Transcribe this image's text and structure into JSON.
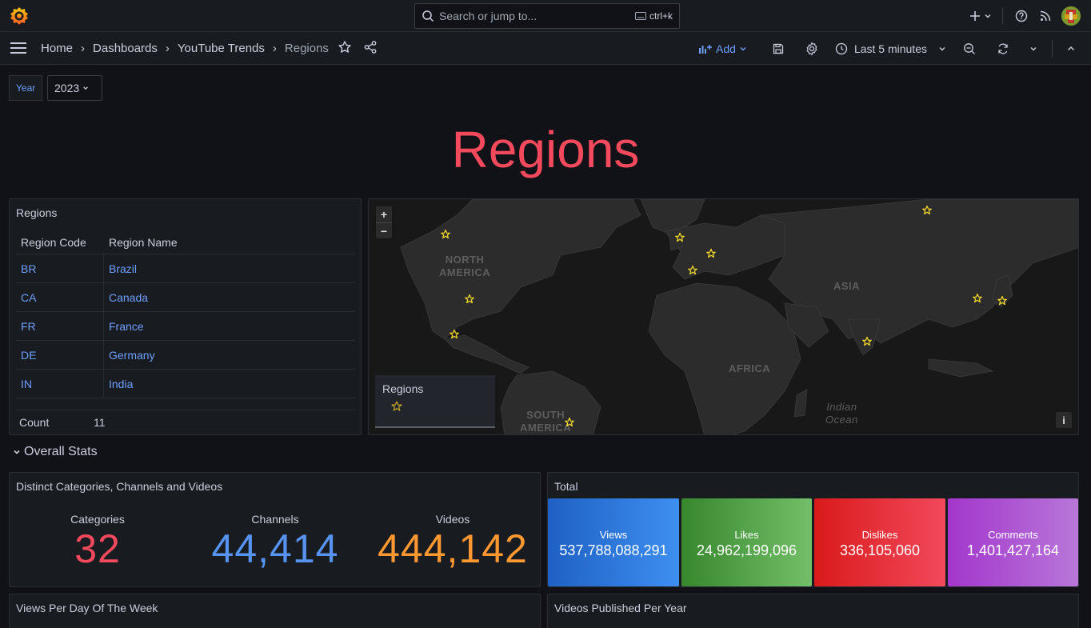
{
  "topbar": {
    "search_placeholder": "Search or jump to...",
    "search_shortcut": "ctrl+k"
  },
  "breadcrumb": {
    "home": "Home",
    "dashboards": "Dashboards",
    "folder": "YouTube Trends",
    "current": "Regions"
  },
  "toolbar": {
    "add_label": "Add",
    "time_range": "Last 5 minutes"
  },
  "variables": {
    "year_label": "Year",
    "year_value": "2023"
  },
  "dashboard_title": "Regions",
  "regions_panel": {
    "title": "Regions",
    "columns": [
      "Region Code",
      "Region Name"
    ],
    "rows": [
      {
        "code": "BR",
        "name": "Brazil"
      },
      {
        "code": "CA",
        "name": "Canada"
      },
      {
        "code": "FR",
        "name": "France"
      },
      {
        "code": "DE",
        "name": "Germany"
      },
      {
        "code": "IN",
        "name": "India"
      }
    ],
    "footer_label": "Count",
    "footer_value": "11"
  },
  "map_panel": {
    "labels": {
      "north_america": "NORTH\nAMERICA",
      "asia": "ASIA",
      "africa": "AFRICA",
      "south_america": "SOUTH\nAMERICA",
      "indian_ocean": "Indian\nOcean"
    },
    "legend_title": "Regions",
    "marker_color": "#fade2a"
  },
  "overall_stats_row": {
    "title": "Overall Stats"
  },
  "distinct_panel": {
    "title": "Distinct Categories, Channels and Videos",
    "stats": [
      {
        "label": "Categories",
        "value": "32",
        "color": "#f2495c"
      },
      {
        "label": "Channels",
        "value": "44,414",
        "color": "#5794f2"
      },
      {
        "label": "Videos",
        "value": "444,142",
        "color": "#ff9830"
      }
    ]
  },
  "total_panel": {
    "title": "Total",
    "tiles": [
      {
        "label": "Views",
        "value": "537,788,088,291"
      },
      {
        "label": "Likes",
        "value": "24,962,199,096"
      },
      {
        "label": "Dislikes",
        "value": "336,105,060"
      },
      {
        "label": "Comments",
        "value": "1,401,427,164"
      }
    ]
  },
  "bottom_panels": {
    "left_title": "Views Per Day Of The Week",
    "right_title": "Videos Published Per Year"
  }
}
